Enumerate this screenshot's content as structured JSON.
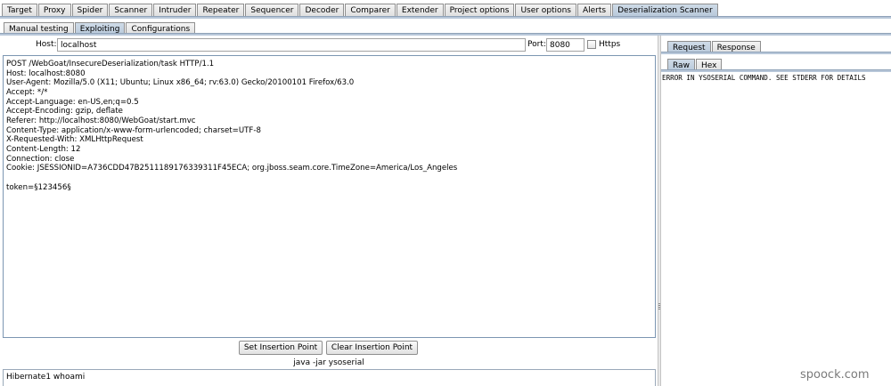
{
  "main_tabs": [
    {
      "label": "Target",
      "active": false
    },
    {
      "label": "Proxy",
      "active": false
    },
    {
      "label": "Spider",
      "active": false
    },
    {
      "label": "Scanner",
      "active": false
    },
    {
      "label": "Intruder",
      "active": false
    },
    {
      "label": "Repeater",
      "active": false
    },
    {
      "label": "Sequencer",
      "active": false
    },
    {
      "label": "Decoder",
      "active": false
    },
    {
      "label": "Comparer",
      "active": false
    },
    {
      "label": "Extender",
      "active": false
    },
    {
      "label": "Project options",
      "active": false
    },
    {
      "label": "User options",
      "active": false
    },
    {
      "label": "Alerts",
      "active": false
    },
    {
      "label": "Deserialization Scanner",
      "active": true
    }
  ],
  "sub_tabs": [
    {
      "label": "Manual testing",
      "active": false
    },
    {
      "label": "Exploiting",
      "active": true
    },
    {
      "label": "Configurations",
      "active": false
    }
  ],
  "target": {
    "host_label": "Host:",
    "host_value": "localhost",
    "port_label": "Port:",
    "port_value": "8080",
    "https_label": "Https",
    "https_checked": false
  },
  "request_lines": [
    "POST /WebGoat/InsecureDeserialization/task HTTP/1.1",
    "Host: localhost:8080",
    "User-Agent: Mozilla/5.0 (X11; Ubuntu; Linux x86_64; rv:63.0) Gecko/20100101 Firefox/63.0",
    "Accept: */*",
    "Accept-Language: en-US,en;q=0.5",
    "Accept-Encoding: gzip, deflate",
    "Referer: http://localhost:8080/WebGoat/start.mvc",
    "Content-Type: application/x-www-form-urlencoded; charset=UTF-8",
    "X-Requested-With: XMLHttpRequest",
    "Content-Length: 12",
    "Connection: close",
    "Cookie: JSESSIONID=A736CDD47B2511189176339311F45ECA; org.jboss.seam.core.TimeZone=America/Los_Angeles",
    "",
    "token=§123456§"
  ],
  "buttons": {
    "set_insertion": "Set Insertion Point",
    "clear_insertion": "Clear Insertion Point"
  },
  "command_label": "java -jar ysoserial",
  "payload_value": "Hibernate1 whoami",
  "right_tabs": [
    {
      "label": "Request",
      "active": true
    },
    {
      "label": "Response",
      "active": false
    }
  ],
  "view_tabs": [
    {
      "label": "Raw",
      "active": true
    },
    {
      "label": "Hex",
      "active": false
    }
  ],
  "response_text": "ERROR IN YSOSERIAL COMMAND. SEE STDERR FOR DETAILS",
  "watermark": "spoock.com",
  "colors": {
    "active_tab": "#b7c8da",
    "tab_strip": "#b8c7d9",
    "editor_border": "#7c96b2"
  }
}
